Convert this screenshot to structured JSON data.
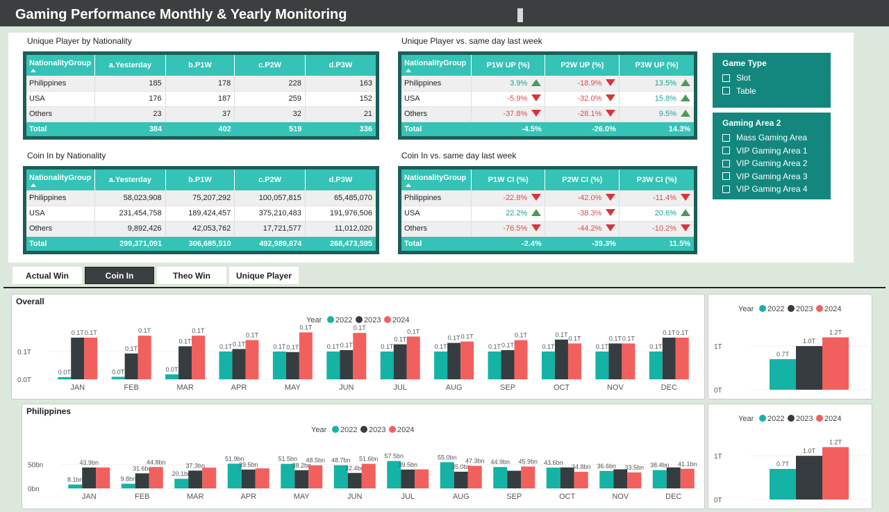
{
  "header": {
    "title": "Gaming Performance Monthly & Yearly Monitoring"
  },
  "colors": {
    "y2022": "#14b3a5",
    "y2023": "#363d40",
    "y2024": "#f2605d",
    "table_header": "#34c3b6",
    "table_border": "#1c5e57",
    "slicer_bg": "#13877d"
  },
  "tables": {
    "unique_player": {
      "title": "Unique Player by Nationality",
      "headers": [
        "NationalityGroup",
        "a.Yesterday",
        "b.P1W",
        "c.P2W",
        "d.P3W"
      ],
      "rows": [
        [
          "Philippines",
          "185",
          "178",
          "228",
          "163"
        ],
        [
          "USA",
          "176",
          "187",
          "259",
          "152"
        ],
        [
          "Others",
          "23",
          "37",
          "32",
          "21"
        ]
      ],
      "total": [
        "Total",
        "384",
        "402",
        "519",
        "336"
      ]
    },
    "coin_in": {
      "title": "Coin In by Nationality",
      "headers": [
        "NationalityGroup",
        "a.Yesterday",
        "b.P1W",
        "c.P2W",
        "d.P3W"
      ],
      "rows": [
        [
          "Philippines",
          "58,023,908",
          "75,207,292",
          "100,057,815",
          "65,485,070"
        ],
        [
          "USA",
          "231,454,758",
          "189,424,457",
          "375,210,483",
          "191,976,506"
        ],
        [
          "Others",
          "9,892,426",
          "42,053,762",
          "17,721,577",
          "11,012,020"
        ]
      ],
      "total": [
        "Total",
        "299,371,091",
        "306,685,510",
        "492,989,874",
        "268,473,595"
      ]
    },
    "unique_player_vs": {
      "title": "Unique Player vs. same day last week",
      "headers": [
        "NationalityGroup",
        "P1W UP (%)",
        "P2W UP (%)",
        "P3W UP (%)"
      ],
      "rows": [
        [
          "Philippines",
          "3.9%",
          "-18.9%",
          "13.5%"
        ],
        [
          "USA",
          "-5.9%",
          "-32.0%",
          "15.8%"
        ],
        [
          "Others",
          "-37.8%",
          "-28.1%",
          "9.5%"
        ]
      ],
      "total": [
        "Total",
        "-4.5%",
        "-26.0%",
        "14.3%"
      ]
    },
    "coin_in_vs": {
      "title": "Coin In vs. same day last week",
      "headers": [
        "NationalityGroup",
        "P1W CI (%)",
        "P2W CI (%)",
        "P3W CI (%)"
      ],
      "rows": [
        [
          "Philippines",
          "-22.8%",
          "-42.0%",
          "-11.4%"
        ],
        [
          "USA",
          "22.2%",
          "-38.3%",
          "20.6%"
        ],
        [
          "Others",
          "-76.5%",
          "-44.2%",
          "-10.2%"
        ]
      ],
      "total": [
        "Total",
        "-2.4%",
        "-39.3%",
        "11.5%"
      ]
    }
  },
  "slicers": {
    "game_type": {
      "title": "Game Type",
      "options": [
        "Slot",
        "Table"
      ]
    },
    "gaming_area": {
      "title": "Gaming Area 2",
      "options": [
        "Mass Gaming Area",
        "VIP Gaming Area 1",
        "VIP Gaming Area 2",
        "VIP Gaming Area 3",
        "VIP Gaming Area 4"
      ]
    }
  },
  "tabs": [
    {
      "label": "Actual Win",
      "active": false
    },
    {
      "label": "Coin In",
      "active": true
    },
    {
      "label": "Theo Win",
      "active": false
    },
    {
      "label": "Unique Player",
      "active": false
    }
  ],
  "chart_data": [
    {
      "type": "bar",
      "title": "Overall",
      "legend_title": "Year",
      "legend_position": "top",
      "categories": [
        "JAN",
        "FEB",
        "MAR",
        "APR",
        "MAY",
        "JUN",
        "JUL",
        "AUG",
        "SEP",
        "OCT",
        "NOV",
        "DEC"
      ],
      "series": [
        {
          "name": "2022",
          "values": [
            0.008,
            0.009,
            0.018,
            0.1,
            0.1,
            0.1,
            0.1,
            0.1,
            0.1,
            0.1,
            0.1,
            0.1
          ],
          "labels": [
            "0.0T",
            "0.0T",
            "0.0T",
            "0.1T",
            "0.1T",
            "0.1T",
            "0.1T",
            "0.1T",
            "0.1T",
            "0.1T",
            "0.1T",
            "0.1T"
          ]
        },
        {
          "name": "2023",
          "values": [
            0.15,
            0.093,
            0.119,
            0.109,
            0.098,
            0.105,
            0.126,
            0.131,
            0.105,
            0.143,
            0.129,
            0.15
          ],
          "labels": [
            "0.1T",
            "0.1T",
            "0.1T",
            "0.1T",
            "0.1T",
            "0.1T",
            "0.1T",
            "0.1T",
            "0.1T",
            "0.1T",
            "0.1T",
            "0.1T"
          ]
        },
        {
          "name": "2024",
          "values": [
            0.15,
            0.157,
            0.157,
            0.141,
            0.169,
            0.167,
            0.154,
            0.136,
            0.141,
            0.129,
            0.129,
            0.15
          ],
          "labels": [
            "0.1T",
            "0.1T",
            "0.1T",
            "0.1T",
            "0.1T",
            "0.1T",
            "0.1T",
            "0.1T",
            "0.1T",
            "0.1T",
            "0.1T",
            "0.1T"
          ]
        }
      ],
      "y_ticks": [
        "0.0T",
        "0.1T"
      ],
      "ylim": [
        0,
        0.2
      ]
    },
    {
      "type": "bar",
      "title": "",
      "legend_title": "Year",
      "legend_position": "top",
      "categories": [
        ""
      ],
      "series": [
        {
          "name": "2022",
          "values": [
            0.7
          ],
          "labels": [
            "0.7T"
          ]
        },
        {
          "name": "2023",
          "values": [
            1.0
          ],
          "labels": [
            "1.0T"
          ]
        },
        {
          "name": "2024",
          "values": [
            1.2
          ],
          "labels": [
            "1.2T"
          ]
        }
      ],
      "y_ticks": [
        "0T",
        "1T"
      ],
      "ylim": [
        0,
        1.4
      ]
    },
    {
      "type": "bar",
      "title": "Philippines",
      "legend_title": "Year",
      "legend_position": "top",
      "categories": [
        "JAN",
        "FEB",
        "MAR",
        "APR",
        "MAY",
        "JUN",
        "JUL",
        "AUG",
        "SEP",
        "OCT",
        "NOV",
        "DEC"
      ],
      "series": [
        {
          "name": "2022",
          "values": [
            8.1,
            9.8,
            20.1,
            51.9,
            51.5,
            48.7,
            57.5,
            55.0,
            44.9,
            43.6,
            36.6,
            38.4
          ],
          "labels": [
            "8.1bn",
            "9.8bn",
            "20.1bn",
            "51.9bn",
            "51.5bn",
            "48.7bn",
            "57.5bn",
            "55.0bn",
            "44.9bn",
            "43.6bn",
            "36.6bn",
            "38.4bn"
          ]
        },
        {
          "name": "2023",
          "values": [
            43.9,
            31.6,
            37.3,
            39.5,
            38.2,
            32.4,
            39.5,
            35.0,
            37.0,
            44.0,
            40.0,
            44.0
          ],
          "labels": [
            "43.9bn",
            "31.6bn",
            "37.3bn",
            "39.5bn",
            "38.2bn",
            "32.4bn",
            "39.5bn",
            "35.0bn",
            "",
            "",
            "",
            ""
          ]
        },
        {
          "name": "2024",
          "values": [
            43.9,
            44.8,
            43.5,
            42.0,
            48.5,
            51.6,
            40.0,
            47.3,
            45.9,
            34.8,
            33.5,
            41.1
          ],
          "labels": [
            "",
            "44.8bn",
            "",
            "",
            "48.5bn",
            "51.6bn",
            "",
            "47.3bn",
            "45.9bn",
            "34.8bn",
            "33.5bn",
            "41.1bn"
          ]
        }
      ],
      "y_ticks": [
        "0bn",
        "50bn"
      ],
      "ylim": [
        0,
        70
      ]
    },
    {
      "type": "bar",
      "title": "",
      "legend_title": "Year",
      "legend_position": "top",
      "categories": [
        ""
      ],
      "series": [
        {
          "name": "2022",
          "values": [
            0.7
          ],
          "labels": [
            "0.7T"
          ]
        },
        {
          "name": "2023",
          "values": [
            1.0
          ],
          "labels": [
            "1.0T"
          ]
        },
        {
          "name": "2024",
          "values": [
            1.2
          ],
          "labels": [
            "1.2T"
          ]
        }
      ],
      "y_ticks": [
        "0T",
        "1T"
      ],
      "ylim": [
        0,
        1.4
      ]
    }
  ]
}
